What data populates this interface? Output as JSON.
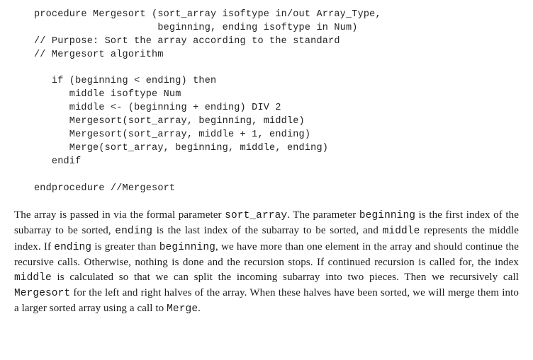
{
  "code": {
    "l01": "procedure Mergesort (sort_array isoftype in/out Array_Type,",
    "l02": "                     beginning, ending isoftype in Num)",
    "l03": "// Purpose: Sort the array according to the standard",
    "l04": "// Mergesort algorithm",
    "l05": "",
    "l06": "   if (beginning < ending) then",
    "l07": "      middle isoftype Num",
    "l08": "      middle <- (beginning + ending) DIV 2",
    "l09": "      Mergesort(sort_array, beginning, middle)",
    "l10": "      Mergesort(sort_array, middle + 1, ending)",
    "l11": "      Merge(sort_array, beginning, middle, ending)",
    "l12": "   endif",
    "l13": "",
    "l14": "endprocedure //Mergesort"
  },
  "prose": {
    "t01": "The array is passed in via the formal parameter ",
    "m01": "sort_array",
    "t02": ". The parameter ",
    "m02": "beginning",
    "t03": " is the first index of the subarray to be sorted, ",
    "m03": "ending",
    "t04": " is the last index of the subarray to be sorted, and ",
    "m04": "middle",
    "t05": " represents the middle index. If ",
    "m05": "ending",
    "t06": " is greater than ",
    "m06": "beginning",
    "t07": ", we have more than one element in the array and should continue the recursive calls. Otherwise, nothing is done and the recursion stops. If continued recursion is called for, the index ",
    "m07": "middle",
    "t08": " is calculated so that we can split the incoming subarray into two pieces. Then we recursively call ",
    "m08": "Mergesort",
    "t09": " for the left and right halves of the array. When these halves have been sorted, we will merge them into a larger sorted array using a call to ",
    "m09": "Merge",
    "t10": "."
  }
}
